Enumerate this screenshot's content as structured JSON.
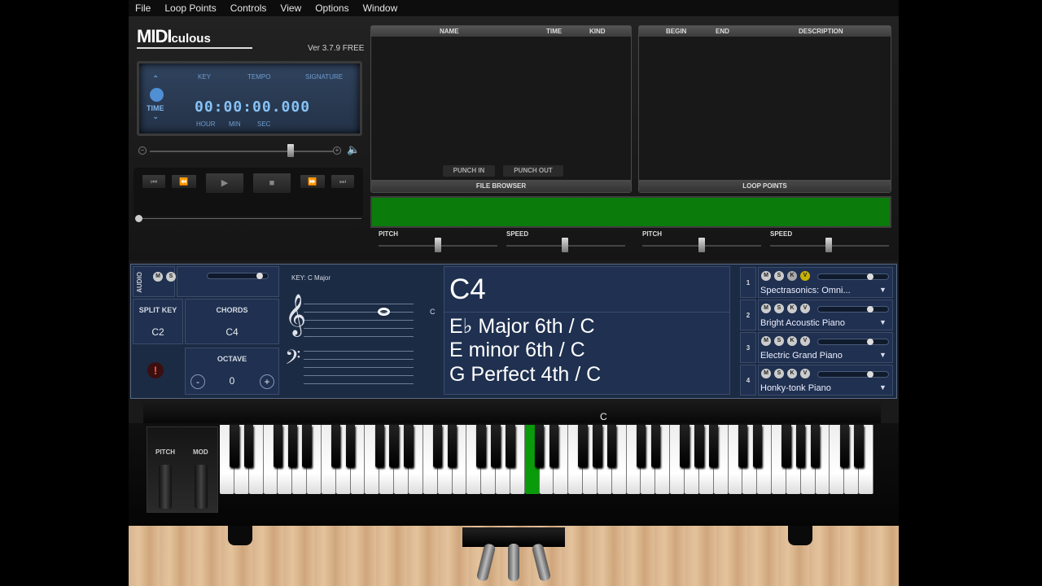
{
  "menu": [
    "File",
    "Loop Points",
    "Controls",
    "View",
    "Options",
    "Window"
  ],
  "logo": {
    "big": "MIDI",
    "small": "culous"
  },
  "version": "Ver 3.7.9 FREE",
  "lcd": {
    "key_label": "KEY",
    "tempo_label": "TEMPO",
    "signature_label": "SIGNATURE",
    "time_label": "TIME",
    "clock": "00:00:00.000",
    "hour": "HOUR",
    "min": "MIN",
    "sec": "SEC"
  },
  "transport": {
    "prev": "⏮",
    "rew": "⏪",
    "play": "▶",
    "stop": "■",
    "ff": "⏩",
    "next": "⏭"
  },
  "file_browser": {
    "col_name": "NAME",
    "col_time": "TIME",
    "col_kind": "KIND",
    "punch_in": "PUNCH IN",
    "punch_out": "PUNCH OUT",
    "footer": "FILE BROWSER"
  },
  "loop_points": {
    "col_begin": "BEGIN",
    "col_end": "END",
    "col_description": "DESCRIPTION",
    "footer": "LOOP POINTS"
  },
  "sliders": {
    "pitch1": "PITCH",
    "speed1": "SPEED",
    "pitch2": "PITCH",
    "speed2": "SPEED"
  },
  "audio": {
    "label": "AUDIO",
    "m": "M",
    "s": "S"
  },
  "key_display": "KEY: C Major",
  "split_key": {
    "label": "SPLIT KEY",
    "value": "C2"
  },
  "chords": {
    "label": "CHORDS",
    "value": "C4"
  },
  "octave": {
    "label": "OCTAVE",
    "value": "0",
    "minus": "-",
    "plus": "+"
  },
  "alert": "!",
  "staff": {
    "treble": "𝄞",
    "bass": "𝄢",
    "note_label": "C"
  },
  "chord_display": {
    "note": "C4",
    "chords": [
      "E♭ Major 6th / C",
      "E minor 6th / C",
      "G Perfect 4th / C"
    ]
  },
  "instruments": [
    {
      "num": "1",
      "name": "Spectrasonics: Omni...",
      "m": "M",
      "s": "S",
      "k": "K",
      "v": "V"
    },
    {
      "num": "2",
      "name": "Bright Acoustic Piano",
      "m": "M",
      "s": "S",
      "k": "K",
      "v": "V"
    },
    {
      "num": "3",
      "name": "Electric Grand Piano",
      "m": "M",
      "s": "S",
      "k": "K",
      "v": "V"
    },
    {
      "num": "4",
      "name": "Honky-tonk Piano",
      "m": "M",
      "s": "S",
      "k": "K",
      "v": "V"
    }
  ],
  "dropdown_arrow": "▼",
  "wheels": {
    "pitch": "PITCH",
    "mod": "MOD"
  },
  "keyboard": {
    "marker": "C",
    "highlight_color": "#0a9b0a"
  }
}
